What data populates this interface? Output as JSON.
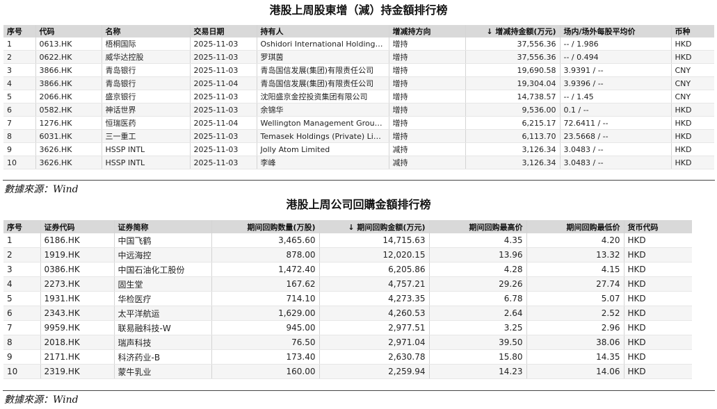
{
  "table1": {
    "title": "港股上周股東增（減）持金額排行榜",
    "headers": [
      "序号",
      "代码",
      "名称",
      "交易日期",
      "持有人",
      "增减持方向",
      "↓ 增减持金额(万元)",
      "场内/场外每股平均价",
      "币种"
    ],
    "rows": [
      [
        "1",
        "0613.HK",
        "梧桐国际",
        "2025-11-03",
        "Oshidori International Holdings Li...",
        "增持",
        "37,556.36",
        "-- / 1.986",
        "HKD"
      ],
      [
        "2",
        "0622.HK",
        "威华达控股",
        "2025-11-03",
        "罗琪茵",
        "增持",
        "37,556.36",
        "-- / 0.494",
        "HKD"
      ],
      [
        "3",
        "3866.HK",
        "青岛银行",
        "2025-11-03",
        "青岛国信发展(集团)有限责任公司",
        "增持",
        "19,690.58",
        "3.9391 / --",
        "CNY"
      ],
      [
        "4",
        "3866.HK",
        "青岛银行",
        "2025-11-04",
        "青岛国信发展(集团)有限责任公司",
        "增持",
        "19,304.04",
        "3.9396 / --",
        "CNY"
      ],
      [
        "5",
        "2066.HK",
        "盛京银行",
        "2025-11-03",
        "沈阳盛京金控投资集团有限公司",
        "增持",
        "14,738.57",
        "-- / 1.45",
        "CNY"
      ],
      [
        "6",
        "0582.HK",
        "神话世界",
        "2025-11-03",
        "余锦华",
        "增持",
        "9,536.00",
        "0.1 / --",
        "HKD"
      ],
      [
        "7",
        "1276.HK",
        "恒瑞医药",
        "2025-11-04",
        "Wellington Management Group LLP",
        "增持",
        "6,215.17",
        "72.6411 / --",
        "HKD"
      ],
      [
        "8",
        "6031.HK",
        "三一重工",
        "2025-11-03",
        "Temasek Holdings (Private) Limited",
        "增持",
        "6,113.70",
        "23.5668 / --",
        "HKD"
      ],
      [
        "9",
        "3626.HK",
        "HSSP INTL",
        "2025-11-03",
        "Jolly Atom Limited",
        "减持",
        "3,126.34",
        "3.0483 / --",
        "HKD"
      ],
      [
        "10",
        "3626.HK",
        "HSSP INTL",
        "2025-11-03",
        "李峰",
        "减持",
        "3,126.34",
        "3.0483 / --",
        "HKD"
      ]
    ],
    "source": "數據來源：Wind"
  },
  "table2": {
    "title": "港股上周公司回購金額排行榜",
    "headers": [
      "序号",
      "证券代码",
      "证券简称",
      "期间回购数量(万股)",
      "↓ 期间回购金额(万元)",
      "期间回购最高价",
      "期间回购最低价",
      "货币代码"
    ],
    "rows": [
      [
        "1",
        "6186.HK",
        "中国飞鹤",
        "3,465.60",
        "14,715.63",
        "4.35",
        "4.20",
        "HKD"
      ],
      [
        "2",
        "1919.HK",
        "中远海控",
        "878.00",
        "12,020.15",
        "13.96",
        "13.32",
        "HKD"
      ],
      [
        "3",
        "0386.HK",
        "中国石油化工股份",
        "1,472.40",
        "6,205.86",
        "4.28",
        "4.15",
        "HKD"
      ],
      [
        "4",
        "2273.HK",
        "固生堂",
        "167.62",
        "4,757.21",
        "29.26",
        "27.74",
        "HKD"
      ],
      [
        "5",
        "1931.HK",
        "华检医疗",
        "714.10",
        "4,273.35",
        "6.78",
        "5.07",
        "HKD"
      ],
      [
        "6",
        "2343.HK",
        "太平洋航运",
        "1,629.00",
        "4,260.53",
        "2.64",
        "2.52",
        "HKD"
      ],
      [
        "7",
        "9959.HK",
        "联易融科技-W",
        "945.00",
        "2,977.51",
        "3.25",
        "2.96",
        "HKD"
      ],
      [
        "8",
        "2018.HK",
        "瑞声科技",
        "76.50",
        "2,971.04",
        "39.50",
        "38.06",
        "HKD"
      ],
      [
        "9",
        "2171.HK",
        "科济药业-B",
        "173.40",
        "2,630.78",
        "15.80",
        "14.35",
        "HKD"
      ],
      [
        "10",
        "2319.HK",
        "蒙牛乳业",
        "160.00",
        "2,259.94",
        "14.23",
        "14.06",
        "HKD"
      ]
    ],
    "source": "數據來源：Wind"
  }
}
